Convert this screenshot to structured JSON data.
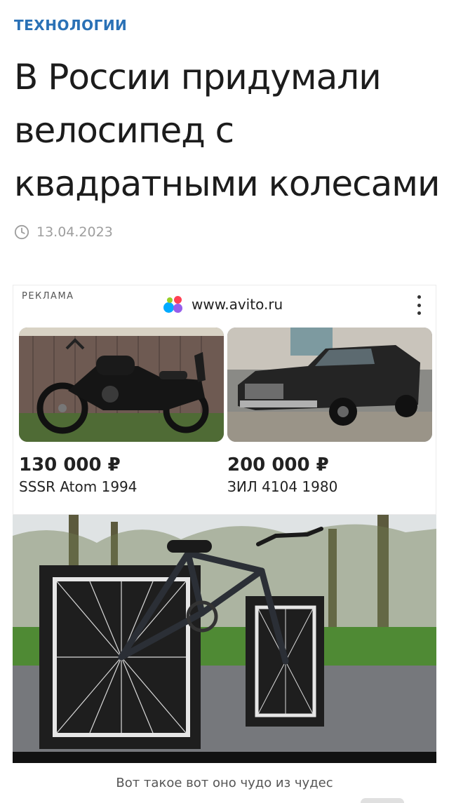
{
  "article": {
    "category": "ТЕХНОЛОГИИ",
    "headline": "В России придумали велосипед с квадратными колесами",
    "date": "13.04.2023",
    "image_caption": "Вот такое вот оно чудо из чудес"
  },
  "ad": {
    "label": "РЕКЛАМА",
    "source": "www.avito.ru",
    "logo_icon": "avito-logo",
    "items": [
      {
        "price": "130 000 ₽",
        "title": "SSSR Atom 1994",
        "image": "motorcycle-photo"
      },
      {
        "price": "200 000 ₽",
        "title": "ЗИЛ 4104 1980",
        "image": "limousine-photo"
      }
    ]
  },
  "colors": {
    "category": "#2a71b6",
    "date": "#9e9e9e",
    "avito_green": "#00aaff",
    "avito_red": "#ff4053",
    "avito_purple": "#965eeb",
    "avito_lime": "#97cf26"
  }
}
